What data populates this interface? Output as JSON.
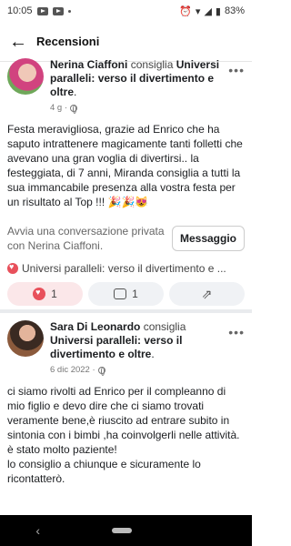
{
  "status_bar": {
    "time": "10:05",
    "battery": "83%"
  },
  "header": {
    "title": "Recensioni",
    "back_icon": "arrow-left-icon"
  },
  "review1": {
    "name": "Nerina Ciaffoni",
    "verb": "consiglia",
    "page": "Universi paralleli: verso il divertimento e oltre",
    "date": "4 g ·",
    "text": "Festa meravigliosa, grazie ad Enrico che ha saputo intrattenere magicamente tanti folletti che avevano una gran voglia di divertirsi.. la festeggiata, di 7 anni, Miranda consiglia a tutti la sua immancabile presenza alla vostra festa per un risultato al Top !!! 🎉🎉😻",
    "message_prompt": "Avvia una conversazione privata con Nerina Ciaffoni.",
    "message_button": "Messaggio",
    "recommend_line": "Universi paralleli: verso il divertimento e ...",
    "likes": "1",
    "comments": "1"
  },
  "review2": {
    "name": "Sara  Di Leonardo",
    "verb": "consiglia",
    "page": "Universi paralleli: verso il divertimento e oltre",
    "date": "6 dic 2022 ·",
    "text": "ci siamo rivolti ad Enrico per il compleanno di mio figlio e devo dire che ci siamo trovati veramente bene,è riuscito ad entrare subito in sintonia con i bimbi ,ha coinvolgerli nelle attività.\nè stato molto paziente!\nlo consiglio a chiunque e sicuramente lo ricontatterò."
  },
  "colors": {
    "accent_red": "#e8505b",
    "divider": "#e9ebee"
  }
}
